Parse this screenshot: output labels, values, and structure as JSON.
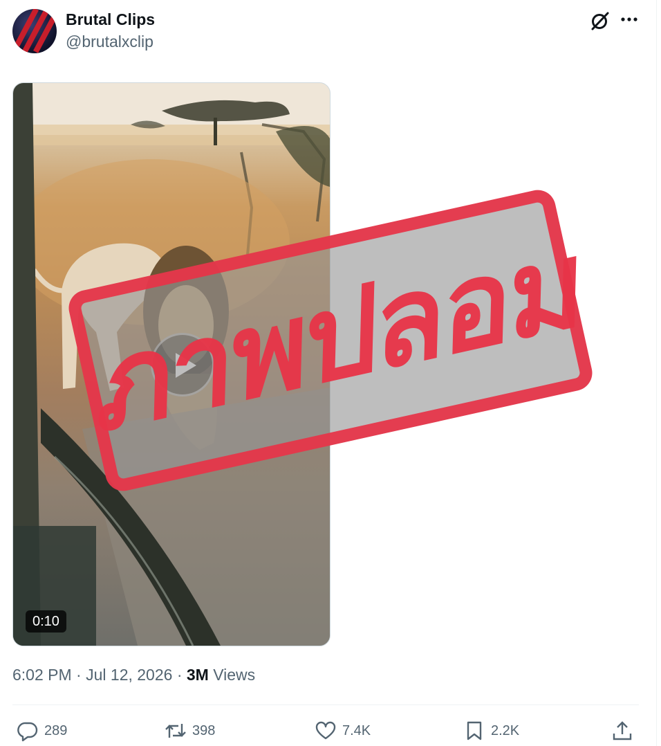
{
  "post": {
    "display_name": "Brutal Clips",
    "handle": "@brutalxclip",
    "video_duration": "0:10",
    "time": "6:02 PM",
    "separator": " · ",
    "date": "Jul 12, 2026",
    "views_count": "3M",
    "views_label": "Views"
  },
  "stamp": {
    "text": "ภาพปลอม",
    "color": "#e73448"
  },
  "actions": {
    "replies": "289",
    "reposts": "398",
    "likes": "7.4K",
    "bookmarks": "2.2K"
  },
  "icons": [
    "grok-icon",
    "more-icon",
    "play-icon",
    "reply-icon",
    "repost-icon",
    "like-icon",
    "bookmark-icon",
    "share-icon"
  ]
}
